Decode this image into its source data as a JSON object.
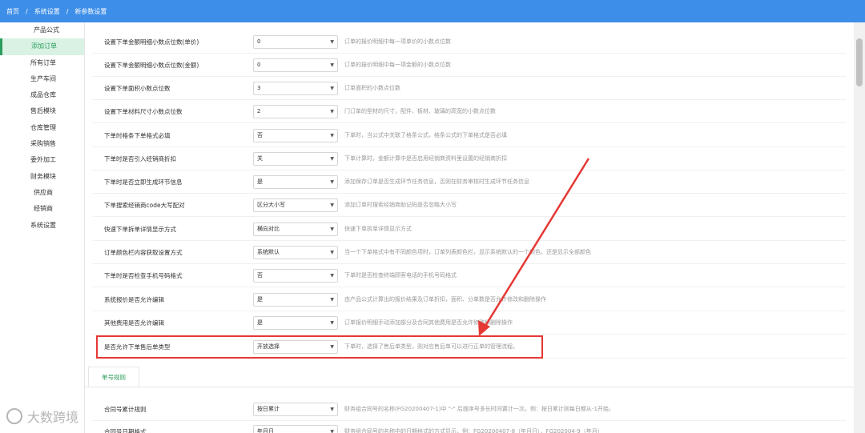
{
  "breadcrumb": [
    "首页",
    "系统设置",
    "新参数设置"
  ],
  "breadcrumb_sep": "/",
  "sidebar": [
    {
      "label": "产品公式",
      "type": "sub"
    },
    {
      "label": "添加订单",
      "type": "active"
    },
    {
      "label": "所有订单",
      "type": "top"
    },
    {
      "label": "生产车间",
      "type": "top"
    },
    {
      "label": "成品仓库",
      "type": "top"
    },
    {
      "label": "售后模块",
      "type": "top"
    },
    {
      "label": "仓库管理",
      "type": "top"
    },
    {
      "label": "采购销售",
      "type": "top"
    },
    {
      "label": "委外加工",
      "type": "top"
    },
    {
      "label": "财务模块",
      "type": "top"
    },
    {
      "label": "供应商",
      "type": "sub"
    },
    {
      "label": "经销商",
      "type": "sub"
    },
    {
      "label": "系统设置",
      "type": "top"
    }
  ],
  "settings": [
    {
      "label": "设置下单金额明细小数点位数(单价)",
      "value": "0",
      "desc": "订单的报价明细中每一项单价的小数点位数"
    },
    {
      "label": "设置下单金额明细小数点位数(金额)",
      "value": "0",
      "desc": "订单的报价明细中每一项金额的小数点位数"
    },
    {
      "label": "设置下单面积小数点位数",
      "value": "3",
      "desc": "订单面积的小数点位数"
    },
    {
      "label": "设置下单材料尺寸小数点位数",
      "value": "2",
      "desc": "门订单的型材的尺寸，配件、板材、玻璃的高宽的小数点位数"
    },
    {
      "label": "下单时格条下单格式必填",
      "value": "否",
      "desc": "下单时，当公式中关联了格条公式，格条公式的下单格式是否必填"
    },
    {
      "label": "下单时是否引入经销商折扣",
      "value": "关",
      "desc": "下单计算时，金额计算中是否启用经销商资料里设置的经销商折扣"
    },
    {
      "label": "下单时是否立即生成环节信息",
      "value": "是",
      "desc": "添加保存订单是否生成环节任务信息，否则在财务审核时生成环节任务信息"
    },
    {
      "label": "下单搜索经销商code大写配对",
      "value": "区分大小写",
      "desc": "添加订单时搜索经销商助记码是否忽略大小写"
    },
    {
      "label": "快速下单拆单详情显示方式",
      "value": "横向对比",
      "desc": "快速下单拆单详情显示方式"
    },
    {
      "label": "订单颜色栏内容获取设置方式",
      "value": "系统默认",
      "desc": "当一个下单格式中有不同颜色项时，订单列表颜色栏，显示系统默认的一个颜色，还是显示全部颜色"
    },
    {
      "label": "下单时是否检查手机号码格式",
      "value": "否",
      "desc": "下单时是否检查终端顾客电话的手机号码格式"
    },
    {
      "label": "系统报价是否允许编辑",
      "value": "是",
      "desc": "由产品公式计算出的报价结果及订单折扣，面积、分单数是否允许修改和删除操作"
    },
    {
      "label": "其他费用是否允许编辑",
      "value": "是",
      "desc": "订单报价明细手动添加部分及合同其他费用是否允许修改和删除操作"
    },
    {
      "label": "是否允许下单售后单类型",
      "value": "开放选择",
      "desc": "下单时，选择了售后单类型，则对应售后单可以进行正单的管理流程。"
    }
  ],
  "tab": "单号规则",
  "settings2": [
    {
      "label": "合同号累计规则",
      "value": "按日累计",
      "desc": "财务组合同号的名称(FG20200407-1)中 \"-\" 后面序号多长时间置计一次。例：按日累计则每日都从-1开始。"
    },
    {
      "label": "合同号日期格式",
      "value": "年月日",
      "desc": "财务组合同号的名称中的日期格式的方式显示，例：FG20200407-8（年月日），FG202004-9（年月）"
    }
  ],
  "watermark": "大数跨境",
  "colors": {
    "header": "#3d8ee8",
    "active": "#2a9d5c",
    "highlight": "#e53935"
  }
}
